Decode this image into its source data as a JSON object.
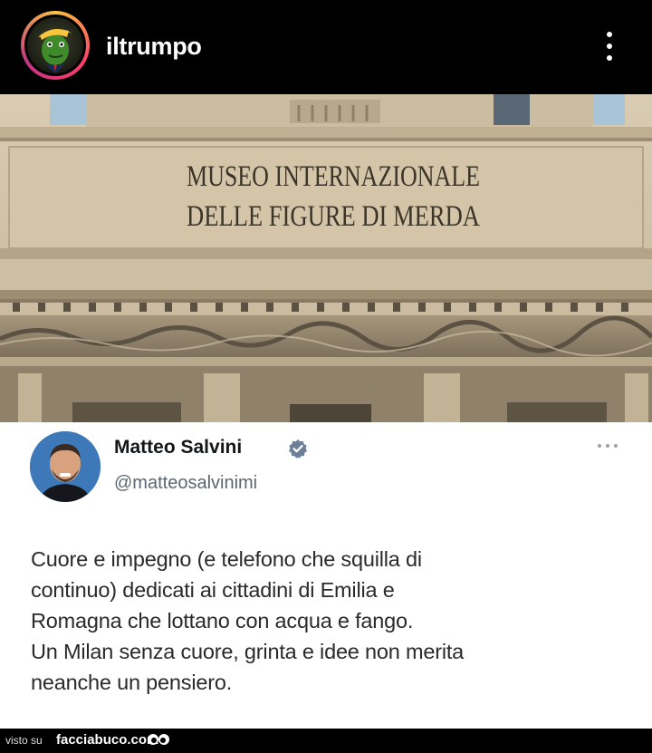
{
  "header": {
    "username": "iltrumpo",
    "avatar_icon": "trump-frog-avatar",
    "menu_icon": "more-vertical-icon"
  },
  "image": {
    "inscription_line1": "MUSEO INTERNAZIONALE",
    "inscription_line2": "DELLE FIGURE DI MERDA"
  },
  "tweet": {
    "author": "Matteo Salvini",
    "handle": "@matteosalvinimi",
    "verified_color": "#1d9bf0",
    "lines": [
      "Cuore e impegno (e telefono che squilla di",
      "continuo) dedicati ai cittadini di Emilia e",
      "Romagna che lottano con acqua e fango.",
      "Un Milan senza cuore, grinta e idee non merita",
      "neanche un pensiero."
    ]
  },
  "footer": {
    "prefix": "visto su",
    "brand": "facciabuco.com"
  }
}
